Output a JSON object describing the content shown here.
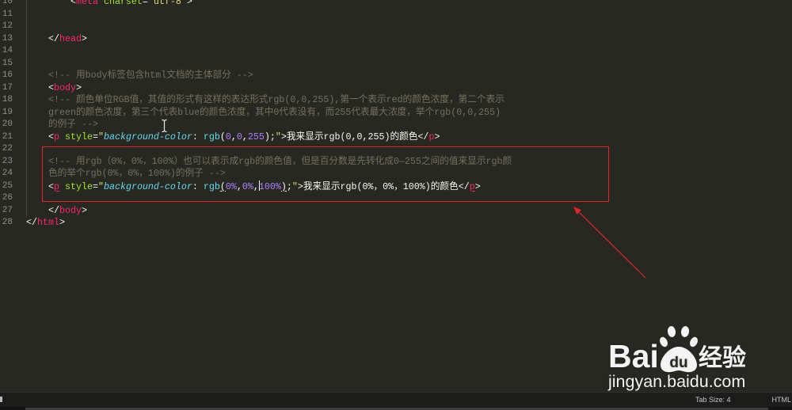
{
  "theme": {
    "background": "#272822",
    "foreground": "#F8F8F2",
    "line_number": "#8F908A",
    "tag": "#F92672",
    "attribute": "#A6E22E",
    "string": "#E6DB74",
    "comment": "#75715E",
    "css_property": "#66D9EF",
    "css_function": "#66D9EF",
    "number": "#AE81FF",
    "annotation": "#E0252B"
  },
  "editor": {
    "lines": [
      {
        "number": "10",
        "tokens": [
          {
            "type": "punctuation",
            "text": "        <"
          },
          {
            "type": "tag",
            "text": "meta"
          },
          {
            "type": "attribute",
            "text": " charset"
          },
          {
            "type": "punctuation",
            "text": "="
          },
          {
            "type": "string",
            "text": "\"utf-8\""
          },
          {
            "type": "punctuation",
            "text": ">"
          }
        ]
      },
      {
        "number": "11",
        "tokens": []
      },
      {
        "number": "12",
        "tokens": []
      },
      {
        "number": "13",
        "tokens": [
          {
            "type": "punctuation",
            "text": "    </"
          },
          {
            "type": "tag",
            "text": "head"
          },
          {
            "type": "punctuation",
            "text": ">"
          }
        ]
      },
      {
        "number": "14",
        "tokens": []
      },
      {
        "number": "15",
        "tokens": []
      },
      {
        "number": "16",
        "tokens": [
          {
            "type": "comment",
            "text": "    <!-- 用body标签包含html文档的主体部分 -->"
          }
        ]
      },
      {
        "number": "17",
        "tokens": [
          {
            "type": "punctuation",
            "text": "    <"
          },
          {
            "type": "tag",
            "text": "body"
          },
          {
            "type": "punctuation",
            "text": ">"
          }
        ]
      },
      {
        "number": "18",
        "tokens": [
          {
            "type": "comment",
            "text": "    <!-- 颜色单位RGB值，其值的形式有这样的表达形式rgb(0,0,255),第一个表示red的颜色浓度，第二个表示"
          }
        ]
      },
      {
        "number": "19",
        "tokens": [
          {
            "type": "comment",
            "text": "    green的颜色浓度，第三个代表blue的颜色浓度，其中0代表没有，而255代表最大浓度，举个rgb(0,0,255)"
          }
        ]
      },
      {
        "number": "20",
        "tokens": [
          {
            "type": "comment",
            "text": "    的例子 -->"
          }
        ]
      },
      {
        "number": "21",
        "tokens": [
          {
            "type": "punctuation",
            "text": "    <"
          },
          {
            "type": "tag",
            "text": "p"
          },
          {
            "type": "attribute",
            "text": " style"
          },
          {
            "type": "punctuation",
            "text": "="
          },
          {
            "type": "string",
            "text": "\""
          },
          {
            "type": "css_property",
            "text": "background-color"
          },
          {
            "type": "punctuation",
            "text": ": "
          },
          {
            "type": "css_function",
            "text": "rgb"
          },
          {
            "type": "punctuation",
            "text": "("
          },
          {
            "type": "number",
            "text": "0"
          },
          {
            "type": "punctuation",
            "text": ","
          },
          {
            "type": "number",
            "text": "0"
          },
          {
            "type": "punctuation",
            "text": ","
          },
          {
            "type": "number",
            "text": "255"
          },
          {
            "type": "punctuation",
            "text": ");"
          },
          {
            "type": "string",
            "text": "\""
          },
          {
            "type": "punctuation",
            "text": ">"
          },
          {
            "type": "text",
            "text": "我来显示rgb(0,0,255)的颜色"
          },
          {
            "type": "punctuation",
            "text": "</"
          },
          {
            "type": "tag",
            "text": "p"
          },
          {
            "type": "punctuation",
            "text": ">"
          }
        ]
      },
      {
        "number": "22",
        "tokens": []
      },
      {
        "number": "23",
        "tokens": [
          {
            "type": "comment",
            "text": "    <!-- 用rgb（0%，0%，100%）也可以表示成rgb的颜色值，但是百分数是先转化成0—255之间的值来显示rgb颜"
          }
        ]
      },
      {
        "number": "24",
        "tokens": [
          {
            "type": "comment",
            "text": "    色的举个rgb(0%，0%，100%)的例子 -->"
          }
        ]
      },
      {
        "number": "25",
        "tokens": [
          {
            "type": "punctuation",
            "text": "    <"
          },
          {
            "type": "tag",
            "text": "p",
            "matched": true
          },
          {
            "type": "attribute",
            "text": " style"
          },
          {
            "type": "punctuation",
            "text": "="
          },
          {
            "type": "string",
            "text": "\""
          },
          {
            "type": "css_property",
            "text": "background-color"
          },
          {
            "type": "punctuation",
            "text": ": "
          },
          {
            "type": "css_function",
            "text": "rgb"
          },
          {
            "type": "punctuation",
            "text": "(",
            "matched": true
          },
          {
            "type": "number",
            "text": "0%"
          },
          {
            "type": "punctuation",
            "text": ","
          },
          {
            "type": "number",
            "text": "0%"
          },
          {
            "type": "punctuation",
            "text": ","
          },
          {
            "type": "caret"
          },
          {
            "type": "number",
            "text": "100%"
          },
          {
            "type": "punctuation",
            "text": ")",
            "matched": true
          },
          {
            "type": "punctuation",
            "text": ";"
          },
          {
            "type": "string",
            "text": "\""
          },
          {
            "type": "punctuation",
            "text": ">"
          },
          {
            "type": "text",
            "text": "我来显示rgb(0%，0%，100%)的颜色"
          },
          {
            "type": "punctuation",
            "text": "</"
          },
          {
            "type": "tag",
            "text": "p",
            "matched": true
          },
          {
            "type": "punctuation",
            "text": ">"
          }
        ]
      },
      {
        "number": "26",
        "tokens": []
      },
      {
        "number": "27",
        "tokens": [
          {
            "type": "punctuation",
            "text": "    </"
          },
          {
            "type": "tag",
            "text": "body"
          },
          {
            "type": "punctuation",
            "text": ">"
          }
        ]
      },
      {
        "number": "28",
        "tokens": [
          {
            "type": "punctuation",
            "text": "</"
          },
          {
            "type": "tag",
            "text": "html"
          },
          {
            "type": "punctuation",
            "text": ">"
          }
        ]
      }
    ]
  },
  "status_bar": {
    "tab_size": "Tab Size: 4",
    "syntax": "HTML"
  },
  "watermark": {
    "bai": "Bai",
    "du": "du",
    "jingyan": "经验",
    "site": "jingyan.baidu.com"
  }
}
